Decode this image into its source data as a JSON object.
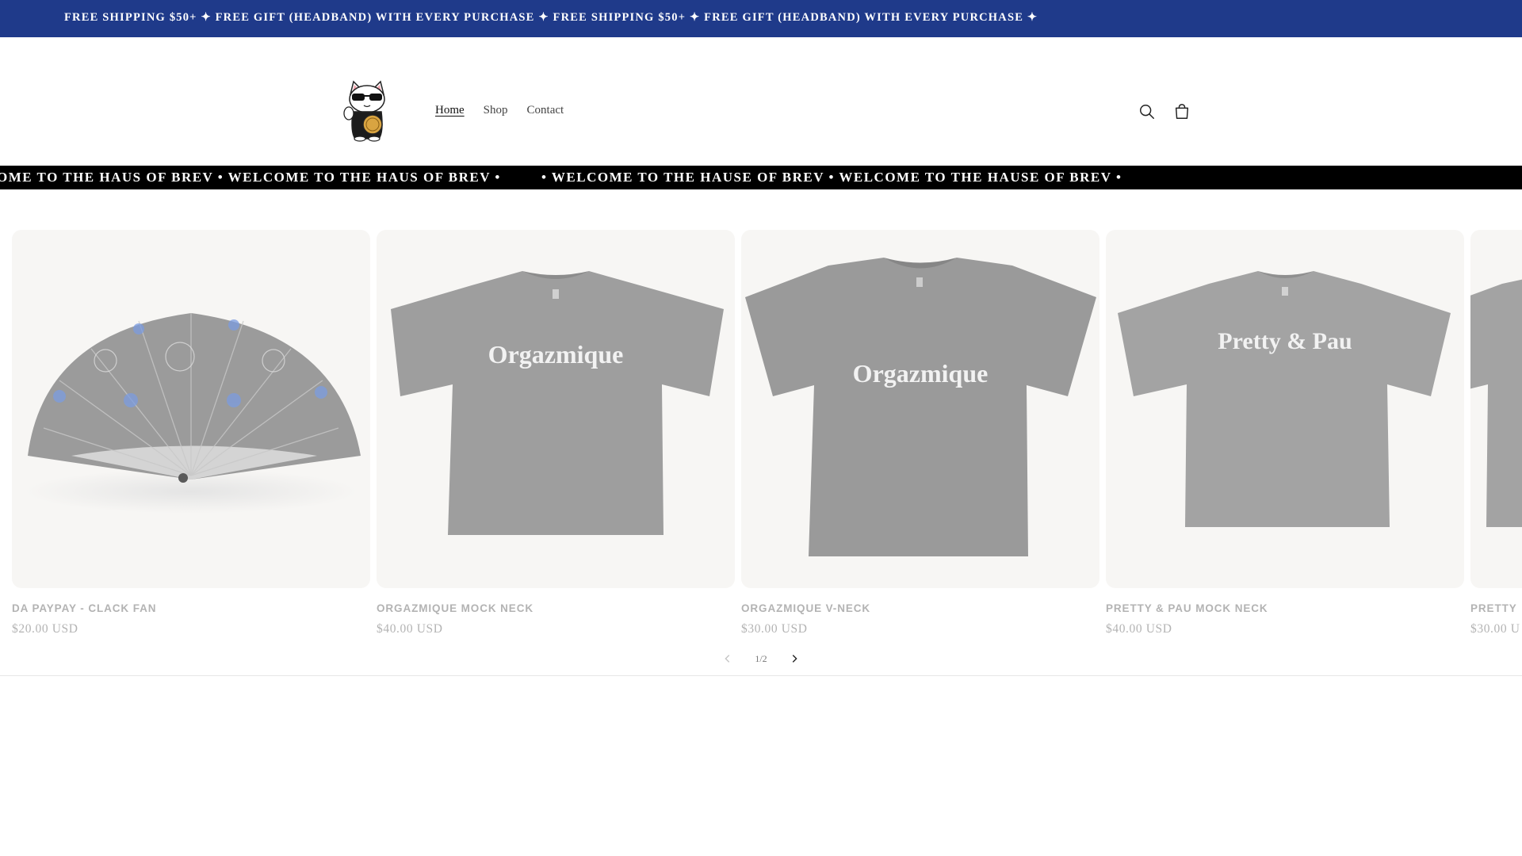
{
  "announcement": {
    "text": "FREE SHIPPING $50+ ✦ FREE GIFT (HEADBAND) WITH EVERY PURCHASE ✦ FREE SHIPPING $50+ ✦ FREE GIFT (HEADBAND) WITH EVERY PURCHASE ✦",
    "background": "#1f3a8a"
  },
  "header": {
    "logo_icon": "lucky-cat-logo",
    "nav": [
      {
        "label": "Home",
        "active": true
      },
      {
        "label": "Shop",
        "active": false
      },
      {
        "label": "Contact",
        "active": false
      }
    ],
    "search_icon": "search-icon",
    "cart_icon": "cart-icon"
  },
  "marquee": {
    "text_1": "OME TO THE HAUS OF BREV • WELCOME TO THE HAUS OF BREV •",
    "text_2": "• WELCOME TO THE HAUSE OF BREV • WELCOME TO THE HAUSE OF BREV •"
  },
  "products": [
    {
      "title": "DA PAYPAY - CLACK FAN",
      "price": "$20.00 USD",
      "image": "fan"
    },
    {
      "title": "ORGAZMIQUE MOCK NECK",
      "price": "$40.00 USD",
      "image": "tshirt",
      "print": "Orgazmique"
    },
    {
      "title": "ORGAZMIQUE V-NECK",
      "price": "$30.00 USD",
      "image": "tshirt",
      "print": "Orgazmique"
    },
    {
      "title": "PRETTY & PAU MOCK NECK",
      "price": "$40.00 USD",
      "image": "tshirt",
      "print": "Pretty & Pau"
    },
    {
      "title": "PRETTY",
      "price": "$30.00 U",
      "image": "tshirt-partial"
    }
  ],
  "slider": {
    "counter": "1/2",
    "prev_icon": "chevron-left-icon",
    "next_icon": "chevron-right-icon"
  }
}
